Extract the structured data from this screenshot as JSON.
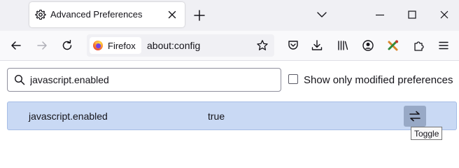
{
  "tab": {
    "title": "Advanced Preferences"
  },
  "urlbar": {
    "identity_label": "Firefox",
    "url": "about:config"
  },
  "search": {
    "value": "javascript.enabled"
  },
  "filter": {
    "show_modified_label": "Show only modified preferences",
    "checked": false
  },
  "preference": {
    "name": "javascript.enabled",
    "value": "true"
  },
  "toggle": {
    "tooltip": "Toggle"
  },
  "colors": {
    "row_highlight": "#c9d9f4",
    "toggle_button": "#98a9c6"
  }
}
